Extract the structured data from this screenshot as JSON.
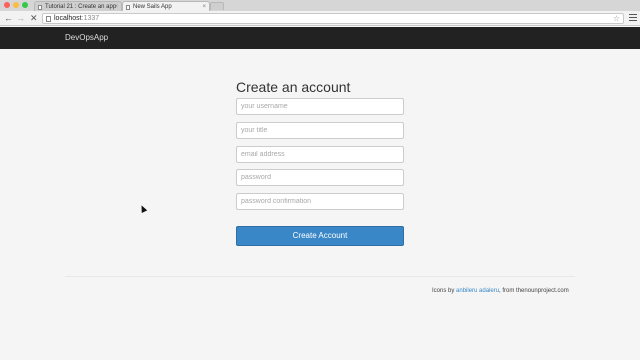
{
  "browser": {
    "tabs": [
      {
        "title": "Tutorial 21 : Create an app",
        "close": "×"
      },
      {
        "title": "New Sails App",
        "close": "×"
      }
    ],
    "url": {
      "host": "localhost",
      "port": ":1337"
    },
    "nav": {
      "back": "←",
      "forward": "→",
      "stop": "✕"
    },
    "star_icon": "☆"
  },
  "app": {
    "brand": "DevOpsApp"
  },
  "form": {
    "title": "Create an account",
    "fields": {
      "username": {
        "placeholder": "your username",
        "value": ""
      },
      "title": {
        "placeholder": "your title",
        "value": ""
      },
      "email": {
        "placeholder": "email address",
        "value": ""
      },
      "password": {
        "placeholder": "password",
        "value": ""
      },
      "password_confirmation": {
        "placeholder": "password confirmation",
        "value": ""
      }
    },
    "submit_label": "Create Account"
  },
  "footer": {
    "prefix": "Icons by ",
    "author": "anbileru adaleru",
    "suffix": ", from thenounproject.com"
  },
  "colors": {
    "navbar": "#222222",
    "primary": "#3a87c7",
    "background": "#f5f5f5"
  }
}
